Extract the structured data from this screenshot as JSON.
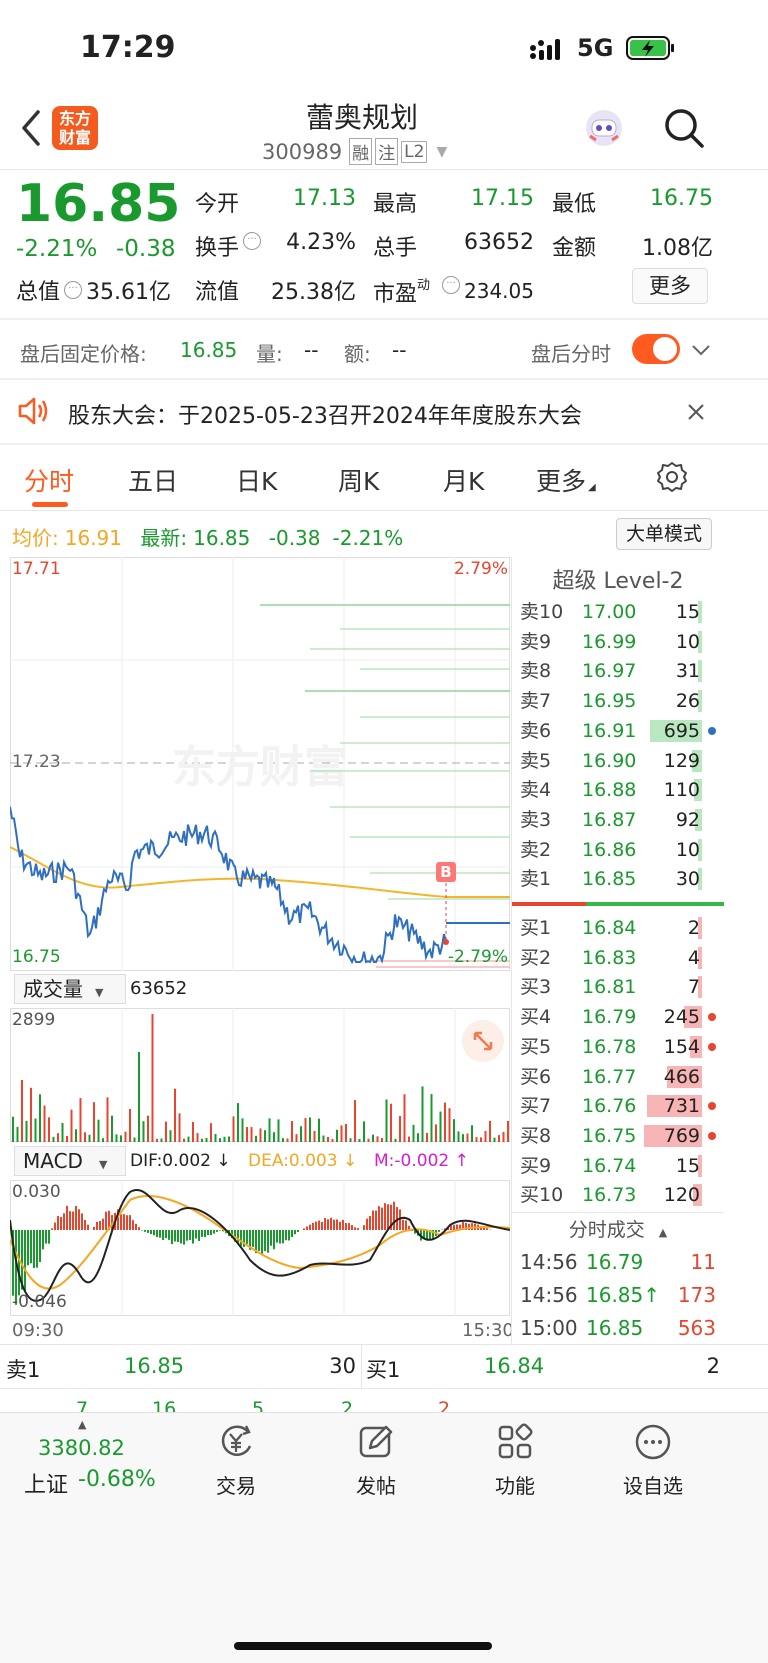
{
  "status": {
    "time": "17:29",
    "net": "5G"
  },
  "header": {
    "logo": [
      "东方",
      "财富"
    ],
    "name": "蕾奥规划",
    "code": "300989",
    "tags": [
      "融",
      "注",
      "L2"
    ]
  },
  "quote": {
    "price": "16.85",
    "pct": "-2.21%",
    "chg": "-0.38",
    "open_l": "今开",
    "open": "17.13",
    "high_l": "最高",
    "high": "17.15",
    "low_l": "最低",
    "low": "16.75",
    "turn_l": "换手",
    "turn": "4.23%",
    "vol_l": "总手",
    "vol": "63652",
    "amt_l": "金额",
    "amt": "1.08亿",
    "mcap_l": "总值",
    "mcap": "35.61亿",
    "fmcap_l": "流值",
    "fmcap": "25.38亿",
    "pe_l": "市盈",
    "pe_sup": "动",
    "pe": "234.05",
    "more": "更多"
  },
  "after": {
    "label": "盘后固定价格:",
    "price": "16.85",
    "vol_l": "量:",
    "vol": "--",
    "amt_l": "额:",
    "amt": "--",
    "toggle_l": "盘后分时"
  },
  "notice": {
    "text": "股东大会：于2025-05-23召开2024年年度股东大会"
  },
  "tabs": [
    "分时",
    "五日",
    "日K",
    "周K",
    "月K",
    "更多"
  ],
  "avgbar": {
    "avg_l": "均价:",
    "avg": "16.91",
    "new_l": "最新:",
    "new": "16.85",
    "chg": "-0.38",
    "pct": "-2.21%",
    "mode": "大单模式"
  },
  "chart": {
    "ymax": "17.71",
    "ymid": "17.23",
    "ymin": "16.75",
    "pmax": "2.79%",
    "pmin": "-2.79%",
    "b": "B",
    "watermark": "东方财富",
    "t_start": "09:30",
    "t_end": "15:30"
  },
  "volume": {
    "label": "成交量",
    "total": "63652",
    "max": "2899"
  },
  "macd": {
    "label": "MACD",
    "dif": "DIF:0.002 ↓",
    "dea": "DEA:0.003 ↓",
    "m": "M:-0.002 ↑",
    "top": "0.030",
    "bottom": "-0.046"
  },
  "level2": {
    "title": "超级 Level-2",
    "asks": [
      [
        "卖10",
        "17.00",
        "15"
      ],
      [
        "卖9",
        "16.99",
        "10"
      ],
      [
        "卖8",
        "16.97",
        "31"
      ],
      [
        "卖7",
        "16.95",
        "26"
      ],
      [
        "卖6",
        "16.91",
        "695"
      ],
      [
        "卖5",
        "16.90",
        "129"
      ],
      [
        "卖4",
        "16.88",
        "110"
      ],
      [
        "卖3",
        "16.87",
        "92"
      ],
      [
        "卖2",
        "16.86",
        "10"
      ],
      [
        "卖1",
        "16.85",
        "30"
      ]
    ],
    "bids": [
      [
        "买1",
        "16.84",
        "2"
      ],
      [
        "买2",
        "16.83",
        "4"
      ],
      [
        "买3",
        "16.81",
        "7"
      ],
      [
        "买4",
        "16.79",
        "245"
      ],
      [
        "买5",
        "16.78",
        "154"
      ],
      [
        "买6",
        "16.77",
        "466"
      ],
      [
        "买7",
        "16.76",
        "731"
      ],
      [
        "买8",
        "16.75",
        "769"
      ],
      [
        "买9",
        "16.74",
        "15"
      ],
      [
        "买10",
        "16.73",
        "120"
      ]
    ],
    "ticks_title": "分时成交",
    "ticks": [
      [
        "14:56",
        "16.79",
        "11"
      ],
      [
        "14:56",
        "16.85↑",
        "173"
      ],
      [
        "15:00",
        "16.85",
        "563"
      ]
    ]
  },
  "bottom_quote": {
    "ask_l": "卖1",
    "ask": "16.85",
    "ask_v": "30",
    "bid_l": "买1",
    "bid": "16.84",
    "bid_v": "2",
    "row2": [
      "7",
      "16",
      "5",
      "2",
      "2"
    ]
  },
  "nav": {
    "index_val": "3380.82",
    "index_name": "上证",
    "index_pct": "-0.68%",
    "items": [
      "交易",
      "发帖",
      "功能",
      "设自选"
    ]
  },
  "colors": {
    "up": "#e8452f",
    "down": "#1a9a2e",
    "accent": "#ff5a1f",
    "price_line": "#2f6fbf",
    "avg_line": "#f5b42a"
  }
}
